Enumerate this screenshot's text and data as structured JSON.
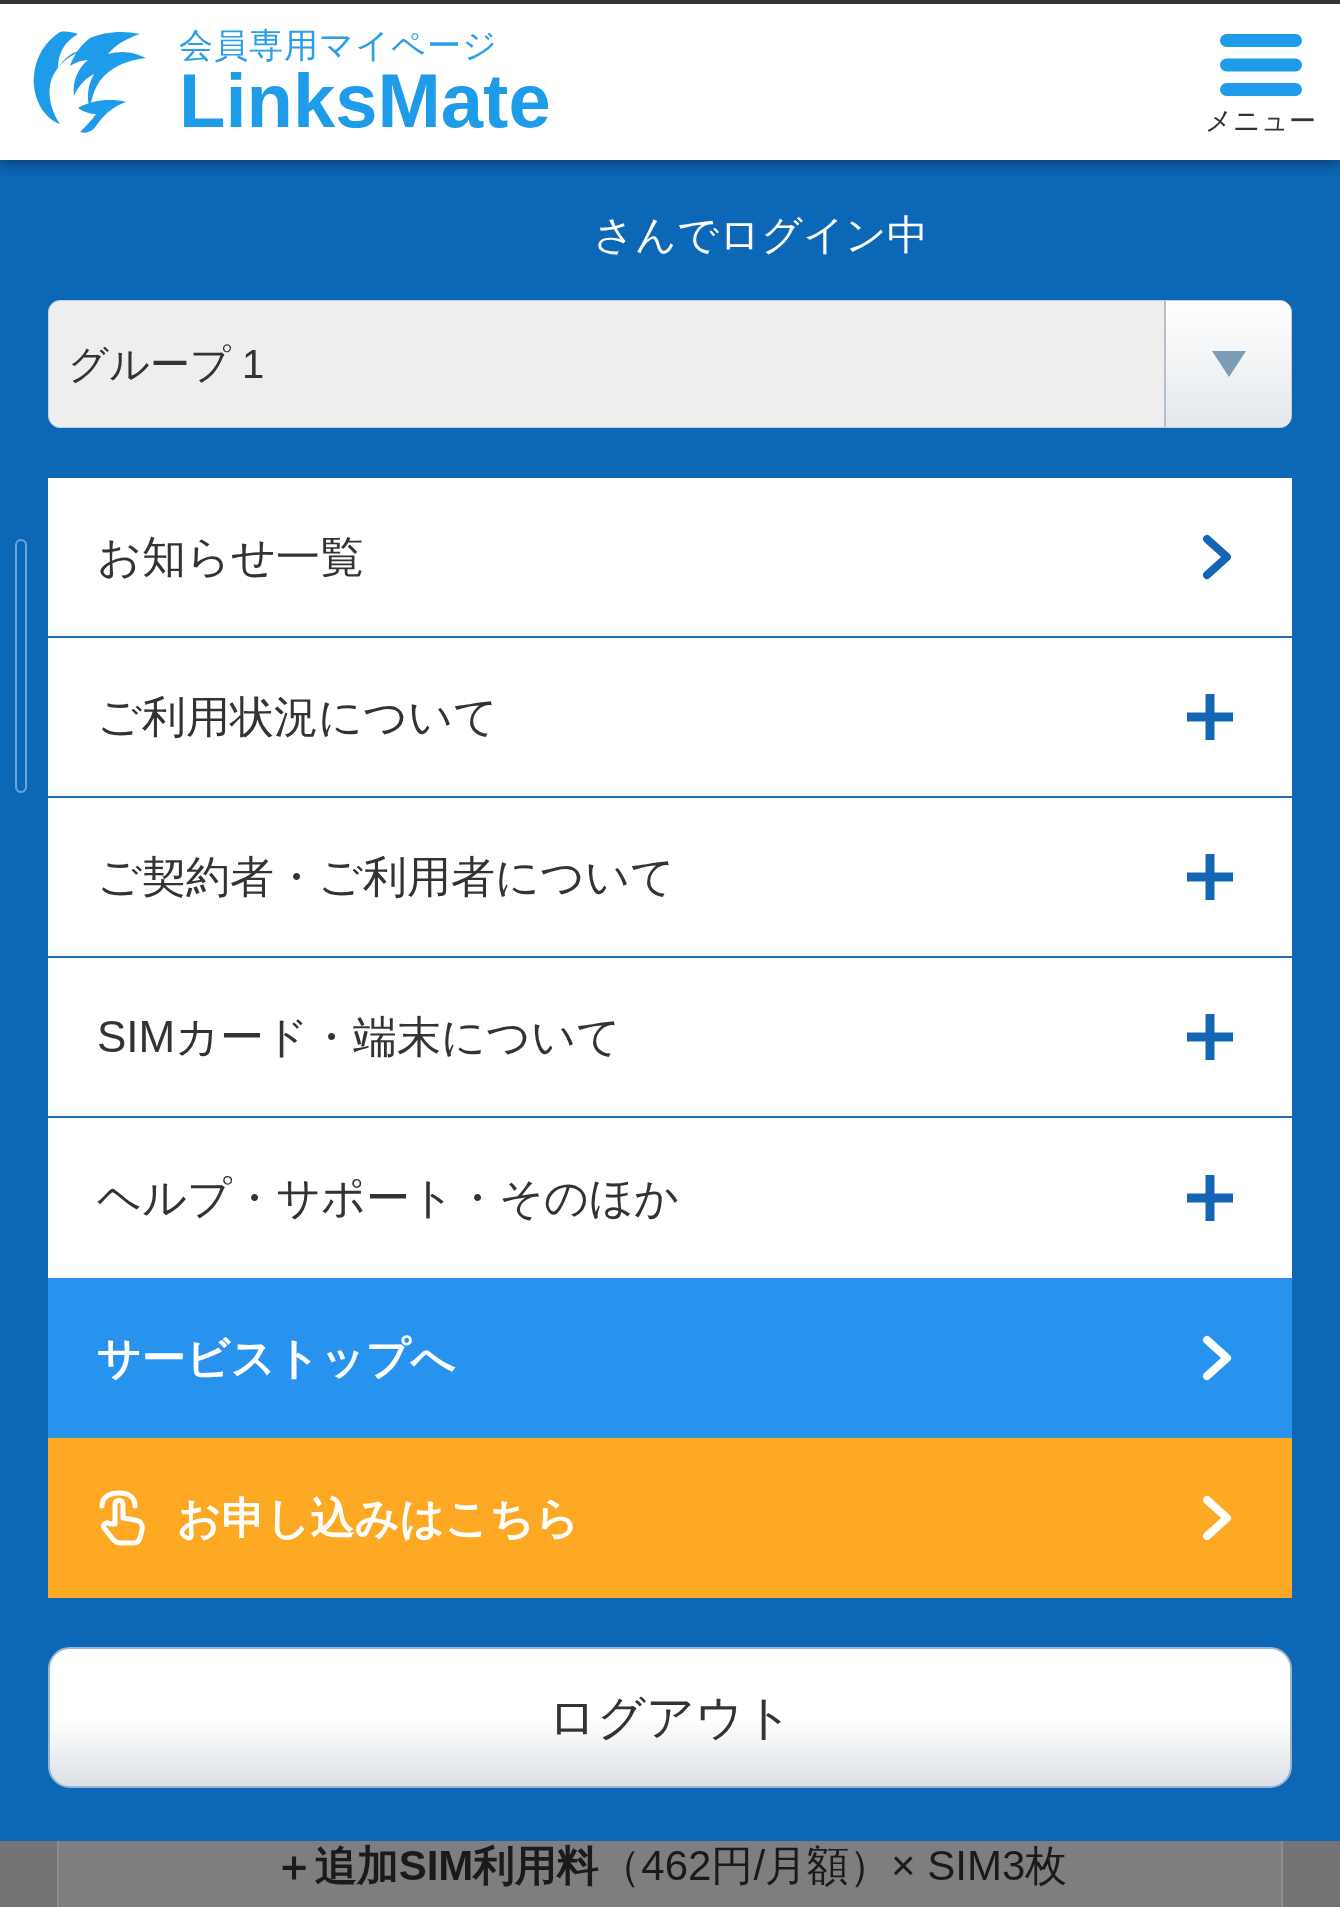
{
  "header": {
    "logo": {
      "subtitle": "会員専用マイページ",
      "wordmark": "LinksMate"
    },
    "menu_button": {
      "label": "メニュー"
    }
  },
  "login_status": {
    "text": "さんでログイン中"
  },
  "group_select": {
    "value": "グループ 1"
  },
  "menu_items": [
    {
      "label": "お知らせ一覧",
      "kind": "link"
    },
    {
      "label": "ご利用状況について",
      "kind": "accordion",
      "expanded": false
    },
    {
      "label": "ご契約者・ご利用者について",
      "kind": "accordion",
      "expanded": false
    },
    {
      "label": "SIMカード・端末について",
      "kind": "accordion",
      "expanded": false
    },
    {
      "label": "ヘルプ・サポート・そのほか",
      "kind": "accordion",
      "expanded": false
    },
    {
      "label": "サービストップへ",
      "kind": "highlight"
    },
    {
      "label": "お申し込みはこちら",
      "kind": "apply"
    }
  ],
  "logout_button": {
    "label": "ログアウト"
  },
  "background_content": {
    "text": "**＋追加SIM利用料**（462円/月額）× SIM3枚"
  }
}
